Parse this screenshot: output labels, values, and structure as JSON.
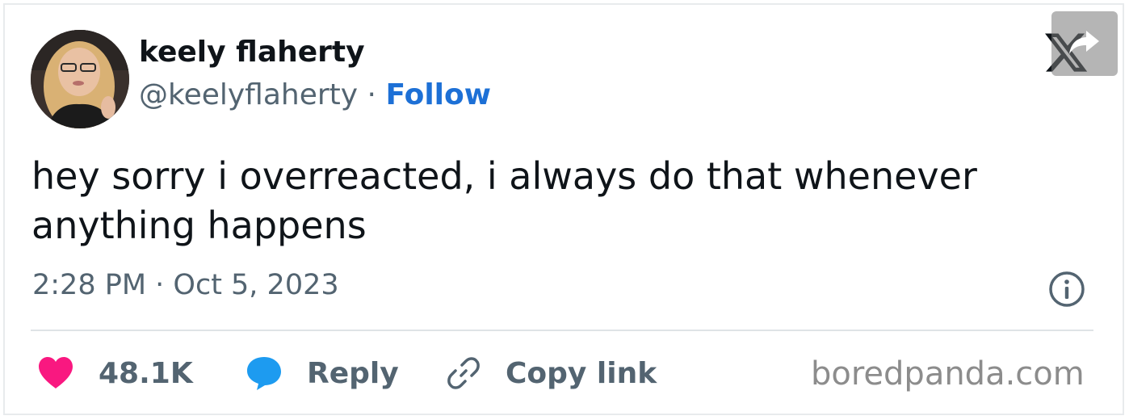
{
  "author": {
    "display_name": "keely flaherty",
    "handle": "@keelyflaherty",
    "separator": "·",
    "follow_label": "Follow"
  },
  "tweet": {
    "text": "hey sorry i overreacted, i always do that whenever anything happens",
    "timestamp": "2:28 PM · Oct 5, 2023"
  },
  "actions": {
    "likes_count": "48.1K",
    "reply_label": "Reply",
    "copy_label": "Copy link"
  },
  "watermark": "boredpanda.com",
  "icons": {
    "brand": "x-logo-icon",
    "share": "share-arrow-icon",
    "info": "info-icon",
    "like": "heart-icon",
    "reply": "speech-bubble-icon",
    "copy": "link-icon"
  },
  "colors": {
    "follow": "#1d70d6",
    "heart": "#f91880",
    "reply_bubble": "#1d9bf0",
    "secondary_text": "#536471"
  }
}
